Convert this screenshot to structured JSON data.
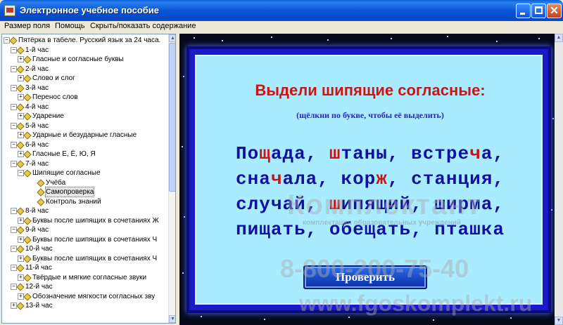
{
  "window": {
    "title": "Электронное учебное пособие"
  },
  "menu": {
    "items": [
      "Размер поля",
      "Помощь",
      "Скрыть/показать содержание"
    ]
  },
  "tree": {
    "items": [
      {
        "label": "Пятёрка в табеле. Русский язык за 24 часа.",
        "level": 0,
        "exp": "−"
      },
      {
        "label": "1-й час",
        "level": 1,
        "exp": "−"
      },
      {
        "label": "Гласные и согласные буквы",
        "level": 2,
        "exp": "+"
      },
      {
        "label": "2-й час",
        "level": 1,
        "exp": "−"
      },
      {
        "label": "Слово и слог",
        "level": 2,
        "exp": "+"
      },
      {
        "label": "3-й час",
        "level": 1,
        "exp": "−"
      },
      {
        "label": "Перенос слов",
        "level": 2,
        "exp": "+"
      },
      {
        "label": "4-й час",
        "level": 1,
        "exp": "−"
      },
      {
        "label": "Ударение",
        "level": 2,
        "exp": "+"
      },
      {
        "label": "5-й час",
        "level": 1,
        "exp": "−"
      },
      {
        "label": "Ударные и безударные гласные",
        "level": 2,
        "exp": "+"
      },
      {
        "label": "6-й час",
        "level": 1,
        "exp": "−"
      },
      {
        "label": "Гласные Е, Ё, Ю, Я",
        "level": 2,
        "exp": "+"
      },
      {
        "label": "7-й час",
        "level": 1,
        "exp": "−"
      },
      {
        "label": "Шипящие согласные",
        "level": 2,
        "exp": "−"
      },
      {
        "label": "Учёба",
        "level": 3,
        "exp": ""
      },
      {
        "label": "Самопроверка",
        "level": 3,
        "exp": "",
        "selected": true
      },
      {
        "label": "Контроль знаний",
        "level": 3,
        "exp": ""
      },
      {
        "label": "8-й час",
        "level": 1,
        "exp": "−"
      },
      {
        "label": "Буквы после шипящих в сочетаниях Ж",
        "level": 2,
        "exp": "+"
      },
      {
        "label": "9-й час",
        "level": 1,
        "exp": "−"
      },
      {
        "label": "Буквы после шипящих в сочетаниях Ч",
        "level": 2,
        "exp": "+"
      },
      {
        "label": "10-й час",
        "level": 1,
        "exp": "−"
      },
      {
        "label": "Буквы после шипящих в сочетаниях Ч",
        "level": 2,
        "exp": "+"
      },
      {
        "label": "11-й час",
        "level": 1,
        "exp": "−"
      },
      {
        "label": "Твёрдые и мягкие согласные звуки",
        "level": 2,
        "exp": "+"
      },
      {
        "label": "12-й час",
        "level": 1,
        "exp": "−"
      },
      {
        "label": "Обозначение мягкости согласных зву",
        "level": 2,
        "exp": "+"
      },
      {
        "label": "13-й час",
        "level": 1,
        "exp": "+"
      }
    ]
  },
  "card": {
    "title": "Выдели шипящие согласные:",
    "hint": "(щёлкни по букве, чтобы её выделить)",
    "lines": [
      {
        "parts": [
          [
            "По",
            false
          ],
          [
            "щ",
            true
          ],
          [
            "ада, ",
            false
          ],
          [
            "ш",
            true
          ],
          [
            "таны, встре",
            false
          ],
          [
            "ч",
            true
          ],
          [
            "а,",
            false
          ]
        ]
      },
      {
        "parts": [
          [
            "сна",
            false
          ],
          [
            "ч",
            true
          ],
          [
            "ала, кор",
            false
          ],
          [
            "ж",
            true
          ],
          [
            ", станция,",
            false
          ]
        ]
      },
      {
        "parts": [
          [
            "случай, ",
            false
          ],
          [
            "ш",
            true
          ],
          [
            "ипящий, ширма,",
            false
          ]
        ]
      },
      {
        "parts": [
          [
            "пищать, обещать, пташка",
            false
          ]
        ]
      }
    ],
    "button_label": "Проверить"
  },
  "watermark": {
    "logo": "Комплектант",
    "sub": "комплектация образовательных учреждений",
    "phone": "8-800-200-75-40",
    "site": "www.fgoskomplekt.ru"
  },
  "colors": {
    "titlebar": "#0756d6",
    "card_bg": "#a9ecff",
    "highlight": "#d41111",
    "text": "#1010a0",
    "button": "#2c6ce8"
  }
}
